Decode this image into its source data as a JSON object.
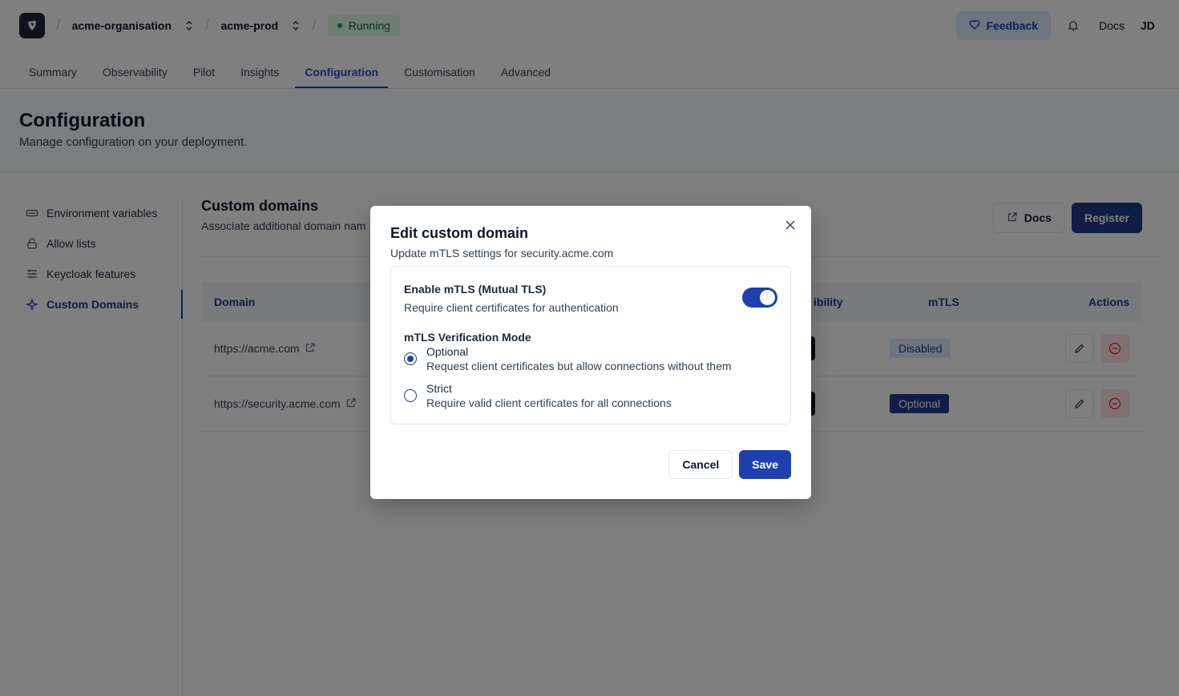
{
  "topbar": {
    "organisation": "acme-organisation",
    "deployment": "acme-prod",
    "status": "Running",
    "feedback_label": "Feedback",
    "docs_label": "Docs",
    "avatar_initials": "JD"
  },
  "tabs": [
    {
      "label": "Summary"
    },
    {
      "label": "Observability"
    },
    {
      "label": "Pilot"
    },
    {
      "label": "Insights"
    },
    {
      "label": "Configuration"
    },
    {
      "label": "Customisation"
    },
    {
      "label": "Advanced"
    }
  ],
  "active_tab": "Configuration",
  "page": {
    "title": "Configuration",
    "subtitle": "Manage configuration on your deployment."
  },
  "sidebar": {
    "items": [
      {
        "label": "Environment variables",
        "icon": "variable-icon"
      },
      {
        "label": "Allow lists",
        "icon": "lock-icon"
      },
      {
        "label": "Keycloak features",
        "icon": "sliders-icon"
      },
      {
        "label": "Custom Domains",
        "icon": "sparkle-icon"
      }
    ],
    "active": "Custom Domains"
  },
  "main": {
    "title": "Custom domains",
    "subtitle": "Associate additional domain nam",
    "docs_label": "Docs",
    "register_label": "Register",
    "table": {
      "headers": {
        "domain": "Domain",
        "visibility": "ibility",
        "mtls": "mTLS",
        "actions": "Actions"
      },
      "rows": [
        {
          "domain": "https://acme.com",
          "mtls": "Disabled"
        },
        {
          "domain": "https://security.acme.com",
          "mtls": "Optional"
        }
      ]
    }
  },
  "modal": {
    "title": "Edit custom domain",
    "subtitle": "Update mTLS settings for security.acme.com",
    "toggle_title": "Enable mTLS (Mutual TLS)",
    "toggle_desc": "Require client certificates for authentication",
    "toggle_on": true,
    "mode_label": "mTLS Verification Mode",
    "options": [
      {
        "title": "Optional",
        "desc": "Request client certificates but allow connections without them",
        "selected": true
      },
      {
        "title": "Strict",
        "desc": "Require valid client certificates for all connections",
        "selected": false
      }
    ],
    "cancel_label": "Cancel",
    "save_label": "Save"
  },
  "colors": {
    "primary": "#1e40af",
    "navy": "#1e3a8a",
    "running_bg": "#dcfce7",
    "danger": "#dc2626"
  }
}
